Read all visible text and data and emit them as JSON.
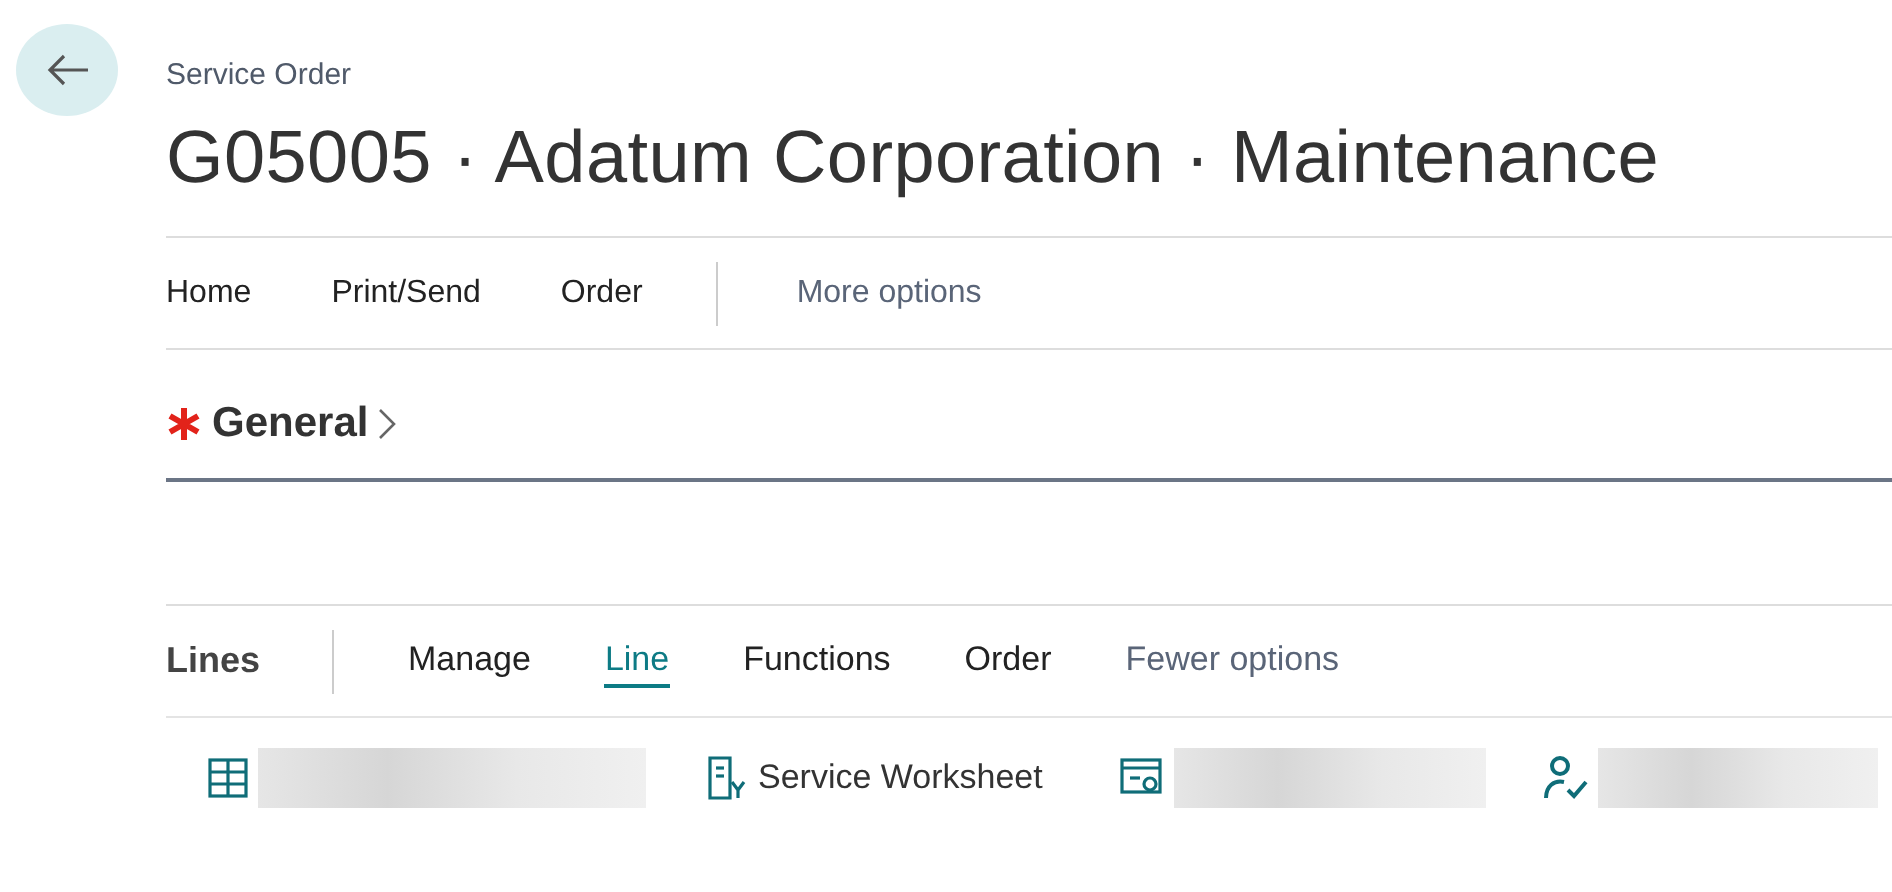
{
  "header": {
    "caption": "Service Order",
    "title": "G05005 · Adatum Corporation · Maintenance"
  },
  "action_bar": [
    {
      "label": "Home",
      "kind": "menu"
    },
    {
      "label": "Print/Send",
      "kind": "menu"
    },
    {
      "label": "Order",
      "kind": "menu"
    },
    {
      "label": "More options",
      "kind": "toggle"
    }
  ],
  "general_section": {
    "title": "General",
    "required": true
  },
  "lines": {
    "title": "Lines",
    "tabs": [
      {
        "label": "Manage",
        "kind": "menu",
        "selected": false
      },
      {
        "label": "Line",
        "kind": "menu",
        "selected": true
      },
      {
        "label": "Functions",
        "kind": "menu",
        "selected": false
      },
      {
        "label": "Order",
        "kind": "menu",
        "selected": false
      },
      {
        "label": "Fewer options",
        "kind": "toggle",
        "selected": false
      }
    ],
    "actions": [
      {
        "kind": "redacted"
      },
      {
        "kind": "labeled",
        "label": "Service Worksheet"
      },
      {
        "kind": "redacted"
      },
      {
        "kind": "redacted"
      }
    ]
  }
}
